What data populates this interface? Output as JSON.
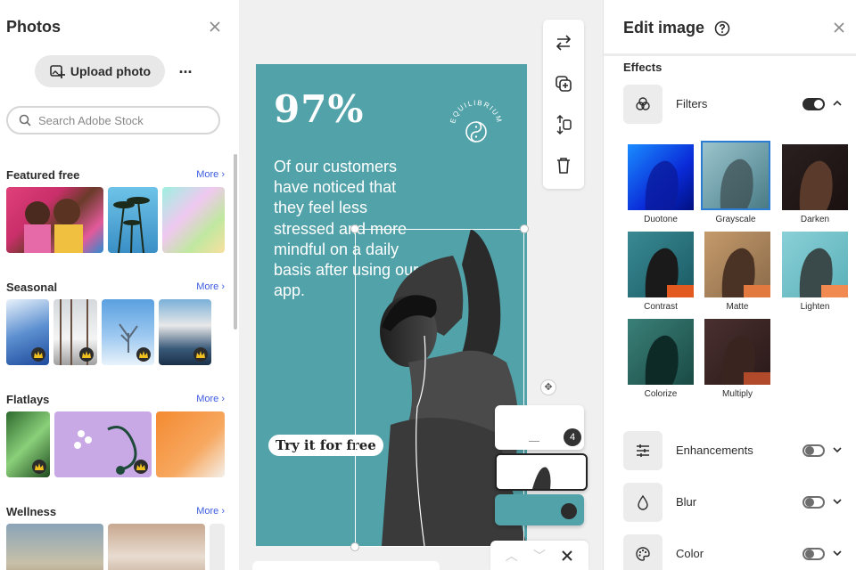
{
  "left_panel": {
    "title": "Photos",
    "upload_label": "Upload photo",
    "more_label": "...",
    "search_placeholder": "Search Adobe Stock",
    "sections": [
      {
        "name": "Featured free",
        "more": "More ›"
      },
      {
        "name": "Seasonal",
        "more": "More ›"
      },
      {
        "name": "Flatlays",
        "more": "More ›"
      },
      {
        "name": "Wellness",
        "more": "More ›"
      }
    ]
  },
  "poster": {
    "headline": "97%",
    "body": "Of our customers have noticed that they feel less stressed and more mindful on a daily basis after using our app.",
    "logo_text": "EQUILIBRIUM",
    "cta": "Try it for free",
    "bg_color": "#52a2a9"
  },
  "pages": {
    "count_badge": "4"
  },
  "right_panel": {
    "title": "Edit image",
    "effects_label": "Effects",
    "filters_label": "Filters",
    "filters_toggle": true,
    "filters": [
      {
        "name": "Duotone",
        "selected": false
      },
      {
        "name": "Grayscale",
        "selected": true
      },
      {
        "name": "Darken",
        "selected": false
      },
      {
        "name": "Contrast",
        "selected": false
      },
      {
        "name": "Matte",
        "selected": false
      },
      {
        "name": "Lighten",
        "selected": false
      },
      {
        "name": "Colorize",
        "selected": false
      },
      {
        "name": "Multiply",
        "selected": false
      }
    ],
    "enhancements_label": "Enhancements",
    "blur_label": "Blur",
    "color_label": "Color"
  },
  "colors": {
    "accent_link": "#3d5ce0",
    "selection_border": "#2c7cd3",
    "teal": "#52a2a9"
  }
}
